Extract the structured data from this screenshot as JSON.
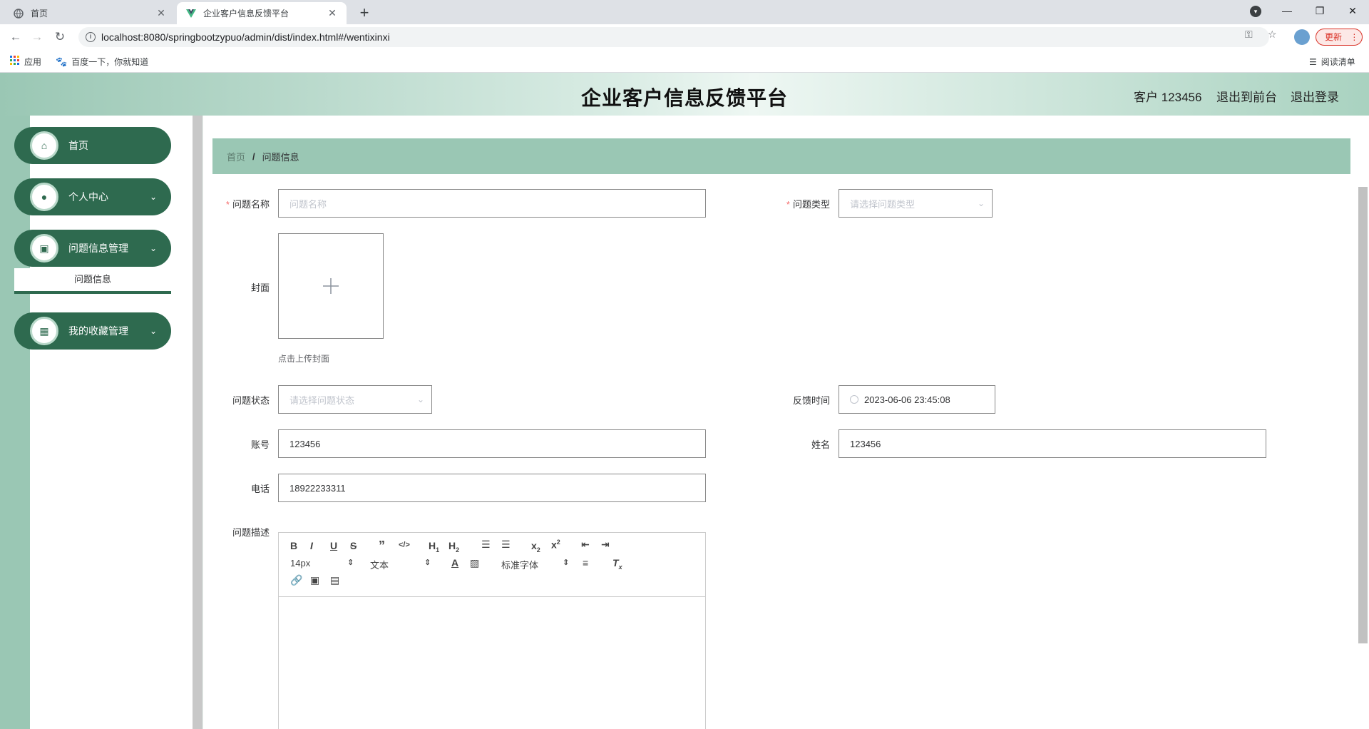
{
  "browser": {
    "tabs": [
      {
        "title": "首页",
        "icon": "globe-icon"
      },
      {
        "title": "企业客户信息反馈平台",
        "icon": "vue-icon"
      }
    ],
    "url": "localhost:8080/springbootzypuo/admin/dist/index.html#/wentixinxi",
    "update_label": "更新",
    "bookmarks": [
      "应用",
      "百度一下，你就知道"
    ],
    "reading_list": "阅读清单"
  },
  "header": {
    "title": "企业客户信息反馈平台",
    "user": "客户 123456",
    "to_front": "退出到前台",
    "logout": "退出登录"
  },
  "sidebar": {
    "items": [
      {
        "label": "首页",
        "icon": "home-icon"
      },
      {
        "label": "个人中心",
        "icon": "user-icon"
      },
      {
        "label": "问题信息管理",
        "icon": "clipboard-icon"
      },
      {
        "label": "我的收藏管理",
        "icon": "grid-icon"
      }
    ],
    "submenu": "问题信息"
  },
  "breadcrumb": {
    "home": "首页",
    "separator": "/",
    "current": "问题信息"
  },
  "form": {
    "name_label": "问题名称",
    "name_placeholder": "问题名称",
    "type_label": "问题类型",
    "type_placeholder": "请选择问题类型",
    "cover_label": "封面",
    "cover_tip": "点击上传封面",
    "status_label": "问题状态",
    "status_placeholder": "请选择问题状态",
    "time_label": "反馈时间",
    "time_value": "2023-06-06 23:45:08",
    "account_label": "账号",
    "account_value": "123456",
    "realname_label": "姓名",
    "realname_value": "123456",
    "phone_label": "电话",
    "phone_value": "18922233311",
    "desc_label": "问题描述"
  },
  "editor": {
    "font_size": "14px",
    "text_style": "文本",
    "font_family": "标准字体"
  },
  "colors": {
    "accent": "#2e6a4f",
    "header_green": "#9ac7b4",
    "required": "#f56c6c"
  }
}
